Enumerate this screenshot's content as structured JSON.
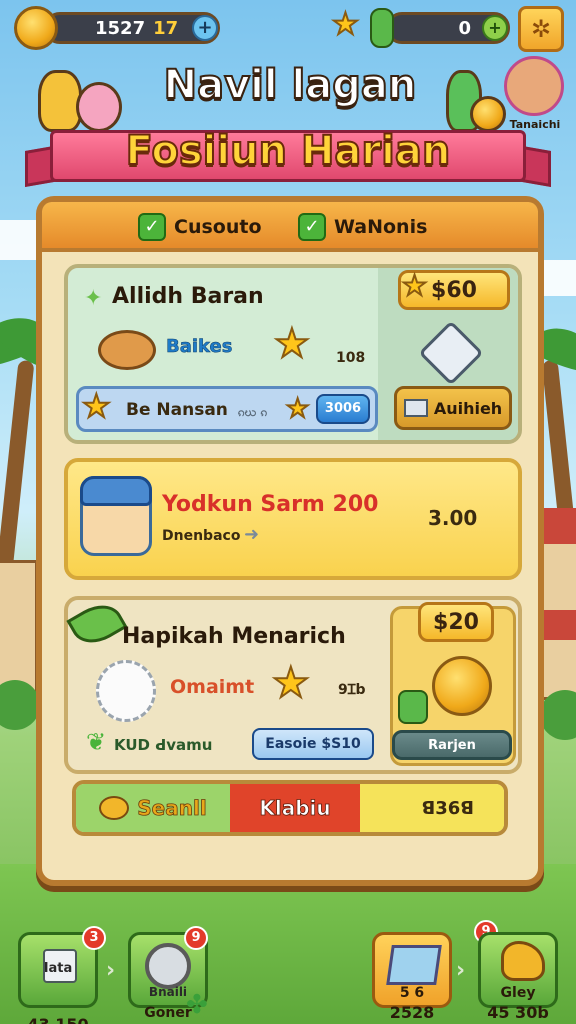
{
  "topbar": {
    "coins": "1527",
    "energy": "17",
    "gems": "0",
    "plus_icon": "plus-icon",
    "settings_icon": "gear-icon"
  },
  "title": {
    "line1": "Navil lagan",
    "line2": "Fosiiun Harian",
    "player_name": "Tanaichi"
  },
  "tabs": [
    {
      "label": "Cusouto"
    },
    {
      "label": "WaNonis"
    }
  ],
  "quests": [
    {
      "title": "Allidh Baran",
      "item_label": "Baikes",
      "item_value": "108",
      "price": "$60",
      "bar_label": "Be Nansan",
      "bar_value": "ၵဃ ၵ",
      "bar_button": "3006",
      "action_label": "Auihieh"
    },
    {
      "title": "Yodkun Sarm 200",
      "subtitle": "Dnenbaco",
      "value": "3.00"
    },
    {
      "title": "Hapikah Menarich",
      "item_label": "Omaimt",
      "item_value": "9Ɪb",
      "price": "$20",
      "bar_label": "KUD ꓒvamu",
      "bar_button": "Easoie $S10",
      "action_label": "Rarjen"
    }
  ],
  "tri_buttons": {
    "left": "Seanll",
    "middle": "Klabiu",
    "right": "ꓭ36ꓭ"
  },
  "bottom_nav": [
    {
      "label": "Iata",
      "value": "43 150",
      "badge": "3"
    },
    {
      "label": "Bnaili",
      "value": "Goner",
      "badge": "9"
    },
    {
      "label": "5 6",
      "value": "2528",
      "badge": "9"
    },
    {
      "label": "Gley",
      "value": "45 30b",
      "badge": "9"
    }
  ],
  "colors": {
    "panel": "#f3e3b8",
    "tri_left": "#9cd46a",
    "tri_middle": "#e0442a",
    "tri_right": "#f5e35a"
  }
}
